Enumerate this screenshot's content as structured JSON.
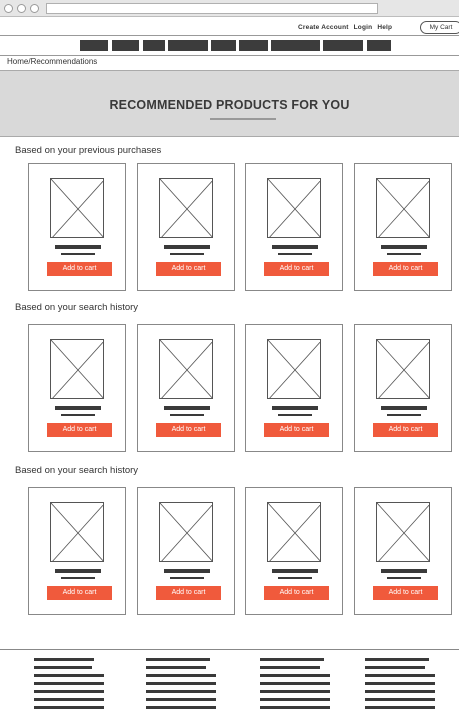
{
  "header": {
    "links": [
      "Create Account",
      "Login",
      "Help"
    ],
    "cart_label": "My Cart",
    "nav_item_count": 9
  },
  "breadcrumb": "Home/Recommendations",
  "hero": {
    "title": "RECOMMENDED PRODUCTS FOR YOU"
  },
  "sections": [
    {
      "title": "Based on your previous purchases",
      "products": [
        {
          "button": "Add to cart"
        },
        {
          "button": "Add to cart"
        },
        {
          "button": "Add to cart"
        },
        {
          "button": "Add to cart"
        }
      ]
    },
    {
      "title": "Based on your search history",
      "products": [
        {
          "button": "Add to cart"
        },
        {
          "button": "Add to cart"
        },
        {
          "button": "Add to cart"
        },
        {
          "button": "Add to cart"
        }
      ]
    },
    {
      "title": "Based on your search history",
      "products": [
        {
          "button": "Add to cart"
        },
        {
          "button": "Add to cart"
        },
        {
          "button": "Add to cart"
        },
        {
          "button": "Add to cart"
        }
      ]
    }
  ],
  "colors": {
    "accent": "#f05a3c",
    "hero_bg": "#d9d9d9",
    "placeholder": "#3a3a3a"
  },
  "icons": {
    "product_image": "image-placeholder-icon"
  }
}
